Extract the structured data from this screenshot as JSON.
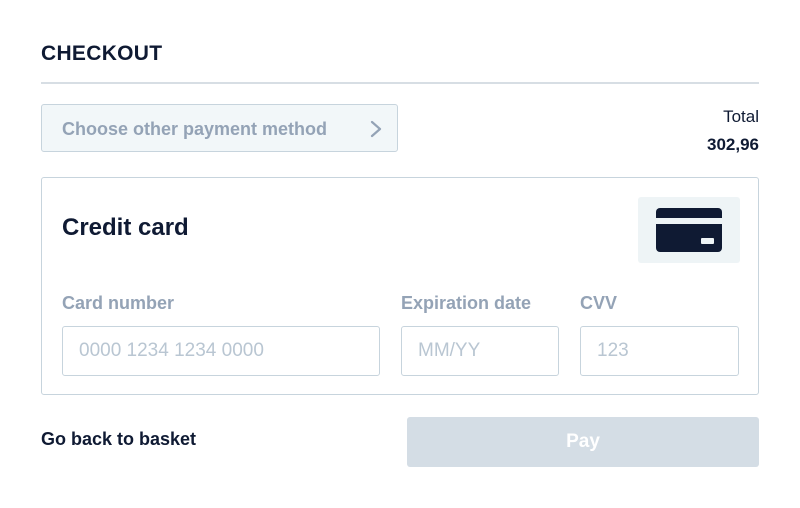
{
  "header": {
    "title": "CHECKOUT"
  },
  "payment_method": {
    "label": "Choose other payment method",
    "icon": "chevron-right-icon"
  },
  "summary": {
    "total_label": "Total",
    "total_value": "302,96"
  },
  "card_form": {
    "title": "Credit card",
    "icon": "credit-card-icon",
    "fields": {
      "card_number": {
        "label": "Card number",
        "placeholder": "0000 1234 1234 0000",
        "value": ""
      },
      "expiration": {
        "label": "Expiration date",
        "placeholder": "MM/YY",
        "value": ""
      },
      "cvv": {
        "label": "CVV",
        "placeholder": "123",
        "value": ""
      }
    }
  },
  "footer": {
    "back_label": "Go back to basket",
    "pay_label": "Pay",
    "pay_enabled": false
  },
  "colors": {
    "text_primary": "#0f1a33",
    "text_muted": "#94a3b6",
    "border": "#c7d4dd",
    "pay_disabled_bg": "#d4dde5",
    "icon_bg": "#eef4f6"
  }
}
